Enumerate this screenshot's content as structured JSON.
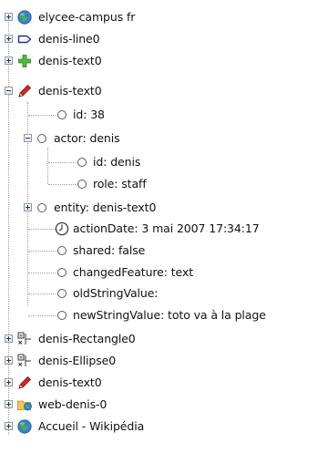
{
  "tree": {
    "root_items": [
      {
        "label": "elycee-campus fr",
        "icon": "globe-icon",
        "expand": "collapsed"
      },
      {
        "label": "denis-line0",
        "icon": "line-shape-icon",
        "expand": "collapsed"
      },
      {
        "label": "denis-text0",
        "icon": "green-plus-icon",
        "expand": "collapsed"
      },
      {
        "label": "denis-text0",
        "icon": "pencil-icon",
        "expand": "expanded",
        "children": [
          {
            "label": "id: 38",
            "icon": "circle-node-icon"
          },
          {
            "label": "actor: denis",
            "icon": "circle-node-icon",
            "expand": "expanded",
            "children": [
              {
                "label": "id: denis",
                "icon": "circle-node-icon"
              },
              {
                "label": "role: staff",
                "icon": "circle-node-icon"
              }
            ]
          },
          {
            "label": "entity: denis-text0",
            "icon": "circle-node-icon",
            "expand": "collapsed"
          },
          {
            "label": "actionDate: 3 mai 2007 17:34:17",
            "icon": "clock-icon"
          },
          {
            "label": "shared: false",
            "icon": "circle-node-icon"
          },
          {
            "label": "changedFeature: text",
            "icon": "circle-node-icon"
          },
          {
            "label": "oldStringValue:",
            "icon": "circle-node-icon"
          },
          {
            "label": "newStringValue: toto va à la plage",
            "icon": "circle-node-icon"
          }
        ]
      },
      {
        "label": "denis-Rectangle0",
        "icon": "shape-tool-icon",
        "expand": "collapsed"
      },
      {
        "label": "denis-Ellipse0",
        "icon": "shape-tool-icon",
        "expand": "collapsed"
      },
      {
        "label": "denis-text0",
        "icon": "pencil-icon",
        "expand": "collapsed"
      },
      {
        "label": "web-denis-0",
        "icon": "folder-globe-icon",
        "expand": "collapsed"
      },
      {
        "label": "Accueil - Wikipédia",
        "icon": "globe-icon",
        "expand": "collapsed"
      }
    ]
  }
}
